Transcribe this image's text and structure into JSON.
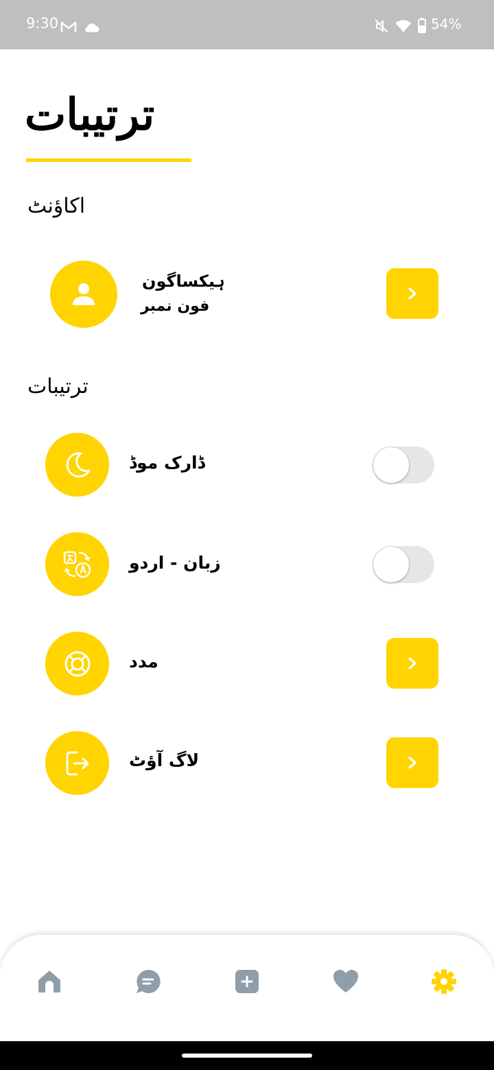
{
  "status_bar": {
    "time": "9:30",
    "battery": "54%",
    "icons": [
      "gmail-icon",
      "cloud-icon",
      "mute-icon",
      "wifi-icon",
      "battery-icon"
    ]
  },
  "header": {
    "title": "ترتیبات"
  },
  "account_section": {
    "title": "اکاؤنٹ",
    "name": "ہیکساگون",
    "phone_label": "فون نمبر"
  },
  "settings_section": {
    "title": "ترتیبات",
    "items": [
      {
        "label": "ڈارک موڈ",
        "icon": "moon-icon",
        "control": "toggle",
        "on": false
      },
      {
        "label": "زبان - اردو",
        "icon": "translate-icon",
        "control": "toggle",
        "on": false
      },
      {
        "label": "مدد",
        "icon": "lifebuoy-icon",
        "control": "arrow"
      },
      {
        "label": "لاگ آؤٹ",
        "icon": "logout-icon",
        "control": "arrow"
      }
    ]
  },
  "bottom_nav": {
    "items": [
      "home-icon",
      "chat-icon",
      "add-icon",
      "heart-icon",
      "settings-gear-icon"
    ],
    "active": "settings-gear-icon"
  },
  "colors": {
    "accent": "#ffd400",
    "nav_inactive": "#8f9ea8",
    "toggle_track": "#e6e6e6",
    "status_bar": "#bfbfbf"
  }
}
